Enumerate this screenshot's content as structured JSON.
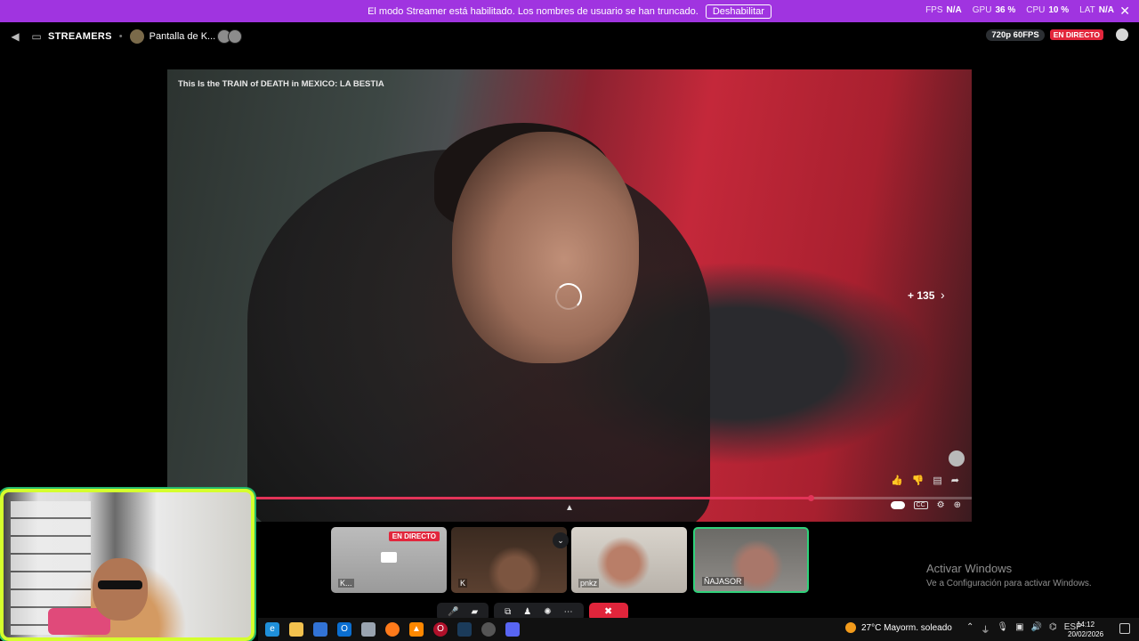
{
  "banner": {
    "message": "El modo Streamer está habilitado. Los nombres de usuario se han truncado.",
    "button": "Deshabilitar",
    "stats": [
      {
        "key": "FPS",
        "value": "N/A"
      },
      {
        "key": "GPU",
        "value": "36 %"
      },
      {
        "key": "CPU",
        "value": "10 %"
      },
      {
        "key": "LAT",
        "value": "N/A"
      }
    ],
    "close_icon": "✕"
  },
  "header": {
    "channel": "STREAMERS",
    "screen_title": "Pantalla de K...",
    "quality": "720p 60FPS",
    "live": "EN DIRECTO"
  },
  "video": {
    "title": "This Is the TRAIN of DEATH in MEXICO: LA BESTIA",
    "more_count": "+ 135",
    "progress_percent": 80
  },
  "participants": [
    {
      "name": "K...",
      "live": "EN DIRECTO"
    },
    {
      "name": "K"
    },
    {
      "name": "pnkz"
    },
    {
      "name": "ÑAJASOR"
    }
  ],
  "activate_windows": {
    "title": "Activar Windows",
    "subtitle": "Ve a Configuración para activar Windows."
  },
  "taskbar": {
    "weather": "27°C  Mayorm. soleado",
    "lang": "ESP",
    "time": "14:12",
    "date": "20/02/2026"
  },
  "colors": {
    "banner": "#a034e0",
    "live": "#e2263c",
    "progress": "#e23458",
    "cam_border": "#d5ff2d",
    "speaking_border": "#2fd27a"
  }
}
